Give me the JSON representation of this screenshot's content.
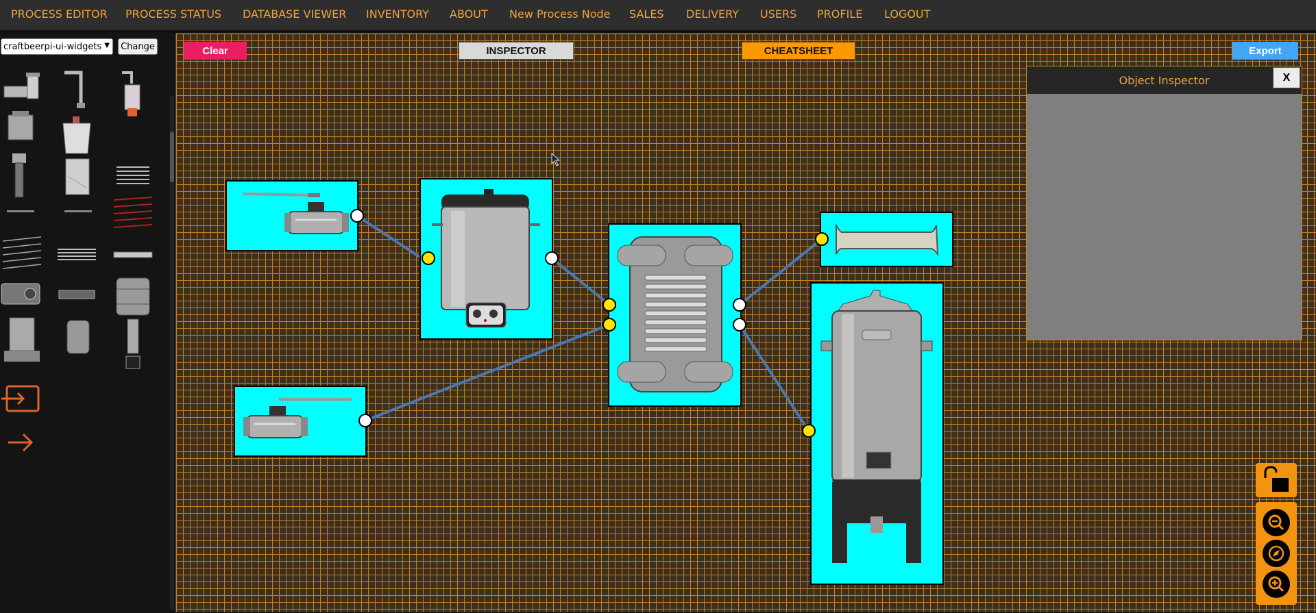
{
  "nav": {
    "items": [
      "PROCESS EDITOR",
      "PROCESS STATUS",
      "DATABASE VIEWER",
      "INVENTORY",
      "ABOUT",
      "New Process Node",
      "SALES",
      "DELIVERY",
      "USERS",
      "PROFILE",
      "LOGOUT"
    ]
  },
  "sidebar": {
    "library_select": "craftbeerpi-ui-widgets",
    "change_label": "Change"
  },
  "toolbar": {
    "clear_label": "Clear",
    "inspector_label": "INSPECTOR",
    "cheatsheet_label": "CHEATSHEET",
    "export_label": "Export"
  },
  "inspector": {
    "title": "Object Inspector",
    "close_label": "X"
  },
  "colors": {
    "accent": "#f2a33a",
    "clear_button": "#e91e63",
    "export_button": "#42a5f5",
    "cheatsheet_button": "#ff9800",
    "node_fill": "#00ffff",
    "input_port": "#ffe500",
    "output_port": "#ffffff",
    "connection": "#4a78b0",
    "grid": "#c97d1f"
  },
  "icons": {
    "lock": "unlock-icon",
    "zoom_out": "zoom-out-icon",
    "fit": "compass-icon",
    "zoom_in": "zoom-in-icon",
    "input_widget": "input-icon",
    "arrow_widget": "arrow-right-icon"
  }
}
